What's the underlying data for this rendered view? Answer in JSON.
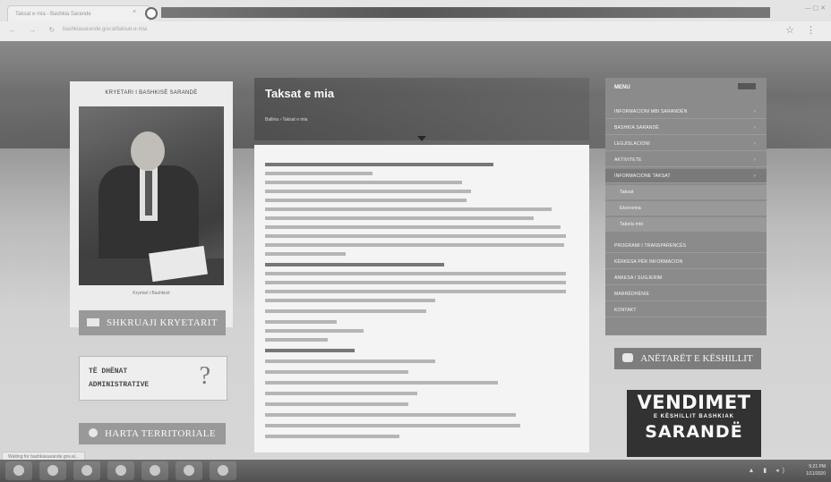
{
  "browser": {
    "tab_title": "Taksat e mia - Bashkia Sarande",
    "tab_close": "×",
    "url": "bashkiasarande.gov.al/taksat-e-mia",
    "nav_glyphs": "← → ↻",
    "right_glyphs": "☆ ⋮",
    "window_controls": "— ▢ ✕"
  },
  "mayor": {
    "title": "KRYETARI I BASHKISË SARANDË",
    "caption": "Kryetari i Bashkisë"
  },
  "left_buttons": {
    "write_mayor": "SHKRUAJI KRYETARIT",
    "admin_line1": "TË DHËNAT",
    "admin_line2": "ADMINISTRATIVE",
    "admin_glyph": "?",
    "map": "HARTA TERRITORIALE"
  },
  "content": {
    "heading": "Taksat e mia",
    "breadcrumb": "Ballina › Taksat e mia"
  },
  "menu": {
    "title": "MENU",
    "items": [
      {
        "label": "INFORMACIONI MBI SARANDËN",
        "arrow": "›"
      },
      {
        "label": "BASHKIA SARANDË",
        "arrow": "›"
      },
      {
        "label": "LEGJISLACIONI",
        "arrow": "›"
      },
      {
        "label": "AKTIVITETE",
        "arrow": "›"
      },
      {
        "label": "INFORMACIONE TAKSAT",
        "arrow": "›"
      },
      {
        "label": "Taksat",
        "arrow": ""
      },
      {
        "label": "Ekonomia",
        "arrow": ""
      },
      {
        "label": "Tabela mbi",
        "arrow": ""
      },
      {
        "label": "PROGRAMI I TRANSPARENCËS",
        "arrow": ""
      },
      {
        "label": "KËRKESA PËR INFORMACION",
        "arrow": ""
      },
      {
        "label": "ANKESA / SUGJERIM",
        "arrow": ""
      },
      {
        "label": "MARRËDHËNIE",
        "arrow": ""
      },
      {
        "label": "KONTAKT",
        "arrow": ""
      }
    ]
  },
  "members_button": "ANËTARËT E KËSHILLIT",
  "vendimet": {
    "line1": "VENDIMET",
    "line2": "E KËSHILLIT BASHKIAK",
    "line3": "SARANDË"
  },
  "status_text": "Waiting for bashkiasarande.gov.al...",
  "clock": {
    "time": "5:21 PM",
    "date": "1/11/2020"
  }
}
